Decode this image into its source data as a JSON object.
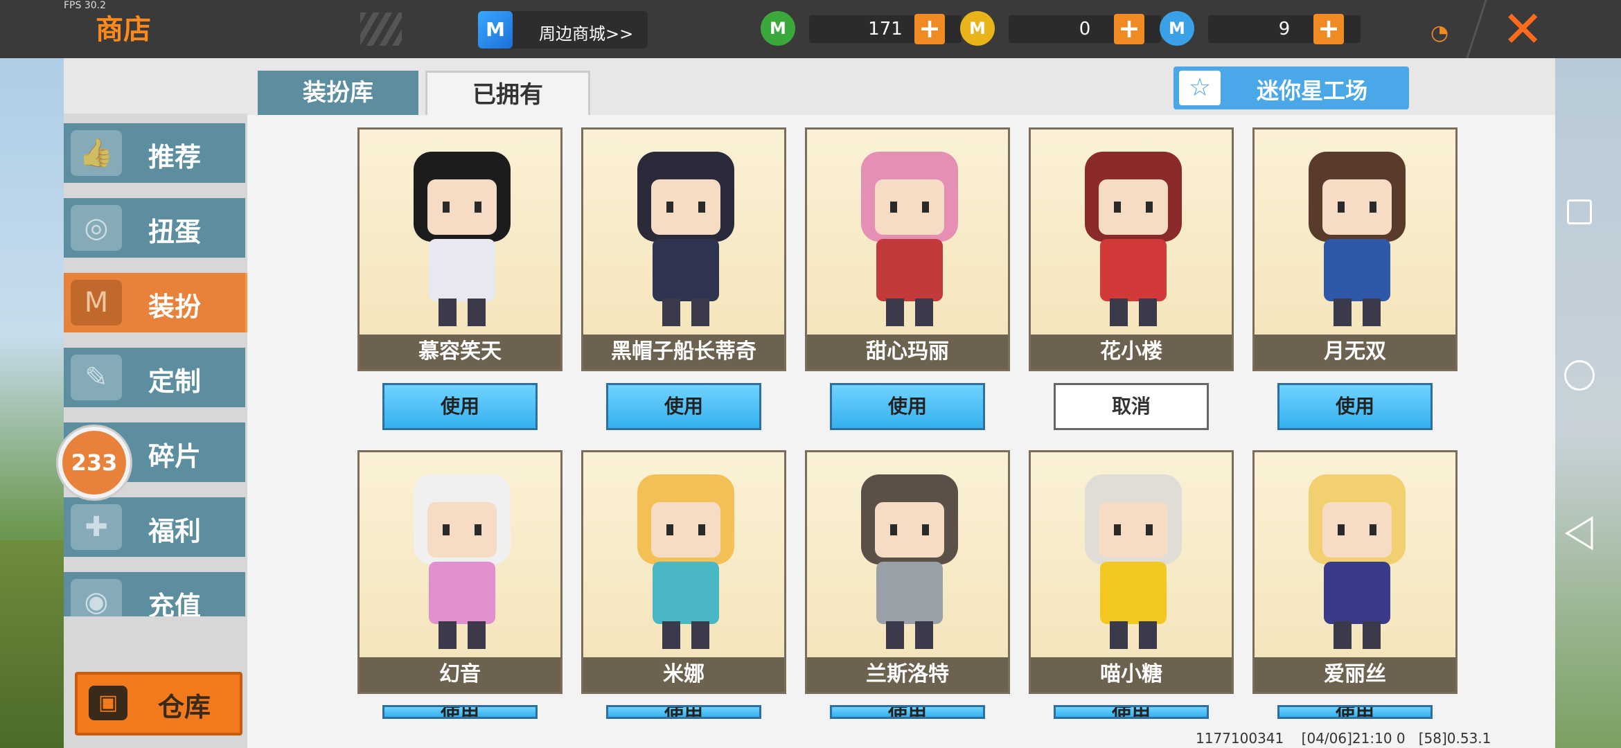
{
  "topbar": {
    "fps": "FPS 30.2",
    "title": "商店",
    "mall_label": "周边商城>>",
    "mall_icon_letter": "M",
    "currencies": [
      {
        "icon": "green-gem-icon",
        "color": "#3aa83a",
        "value": "171",
        "plus": "+"
      },
      {
        "icon": "gold-coin-icon",
        "color": "#e8b41a",
        "value": "0",
        "plus": "+"
      },
      {
        "icon": "mini-coin-icon",
        "color": "#3aa0e8",
        "value": "9",
        "plus": "+"
      }
    ],
    "coin_letter": "M",
    "close": "✕",
    "rss": "◔"
  },
  "sidebar": {
    "items": [
      {
        "label": "推荐",
        "icon": "thumbs-up-icon",
        "glyph": "👍",
        "active": false
      },
      {
        "label": "扭蛋",
        "icon": "capsule-icon",
        "glyph": "◎",
        "active": false
      },
      {
        "label": "装扮",
        "icon": "shirt-icon",
        "glyph": "M",
        "active": true
      },
      {
        "label": "定制",
        "icon": "pencil-icon",
        "glyph": "✎",
        "active": false
      },
      {
        "label": "碎片",
        "icon": "fragment-icon",
        "glyph": "◆",
        "active": false
      },
      {
        "label": "福利",
        "icon": "gift-icon",
        "glyph": "✚",
        "active": false
      },
      {
        "label": "充值",
        "icon": "coins-icon",
        "glyph": "◉",
        "active": false
      }
    ],
    "badge": "233",
    "warehouse_label": "仓库",
    "warehouse_glyph": "▣"
  },
  "tabs": {
    "inactive": "装扮库",
    "active": "已拥有"
  },
  "studio": {
    "label": "迷你星工场",
    "glyph": "☆"
  },
  "cards": [
    {
      "name": "慕容笑天",
      "button": "使用",
      "cancel": false,
      "hair": "#1c1c1c",
      "outfit": "#e8e8f0"
    },
    {
      "name": "黑帽子船长蒂奇",
      "button": "使用",
      "cancel": false,
      "hair": "#2a2a3a",
      "outfit": "#2f3450"
    },
    {
      "name": "甜心玛丽",
      "button": "使用",
      "cancel": false,
      "hair": "#e58fb4",
      "outfit": "#c23a3a"
    },
    {
      "name": "花小楼",
      "button": "取消",
      "cancel": true,
      "hair": "#8a2a2a",
      "outfit": "#d23a3a"
    },
    {
      "name": "月无双",
      "button": "使用",
      "cancel": false,
      "hair": "#5a3a2a",
      "outfit": "#2f58a8"
    },
    {
      "name": "幻音",
      "button": "使用",
      "cancel": false,
      "hair": "#f0f0f0",
      "outfit": "#e28fd0"
    },
    {
      "name": "米娜",
      "button": "使用",
      "cancel": false,
      "hair": "#f2c055",
      "outfit": "#4ab8c4"
    },
    {
      "name": "兰斯洛特",
      "button": "使用",
      "cancel": false,
      "hair": "#5a5048",
      "outfit": "#9aa0a8"
    },
    {
      "name": "喵小糖",
      "button": "使用",
      "cancel": false,
      "hair": "#e0dcd6",
      "outfit": "#f2c820"
    },
    {
      "name": "爱丽丝",
      "button": "使用",
      "cancel": false,
      "hair": "#f2d070",
      "outfit": "#3a3a8a"
    }
  ],
  "status": "1177100341    [04/06]21:10 0   [58]0.53.1"
}
